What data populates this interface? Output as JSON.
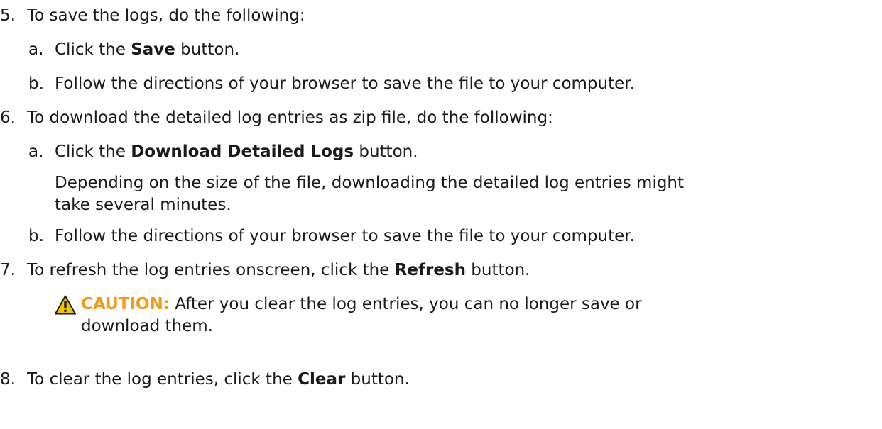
{
  "steps": {
    "s5": {
      "num": "5.",
      "text": "To save the logs, do the following:"
    },
    "s5a": {
      "num": "a.",
      "pre": "Click the ",
      "bold": "Save",
      "post": " button."
    },
    "s5b": {
      "num": "b.",
      "text": "Follow the directions of your browser to save the file to your computer."
    },
    "s6": {
      "num": "6.",
      "text": "To download the detailed log entries as zip file, do the following:"
    },
    "s6a": {
      "num": "a.",
      "pre": "Click the ",
      "bold": "Download Detailed Logs",
      "post": " button."
    },
    "s6a_note_line1": "Depending on the size of the file, downloading the detailed log entries might",
    "s6a_note_line2": "take several minutes.",
    "s6b": {
      "num": "b.",
      "text": "Follow the directions of your browser to save the file to your computer."
    },
    "s7": {
      "num": "7.",
      "pre": "To refresh the log entries onscreen, click the ",
      "bold": "Refresh",
      "post": " button."
    },
    "s8": {
      "num": "8.",
      "pre": "To clear the log entries, click the ",
      "bold": "Clear",
      "post": " button."
    }
  },
  "caution": {
    "icon": "warning-triangle-icon",
    "label": "CAUTION:",
    "line1": " After you clear the log entries, you can no longer save or",
    "line2": "download them.",
    "color": "#f39a16"
  }
}
